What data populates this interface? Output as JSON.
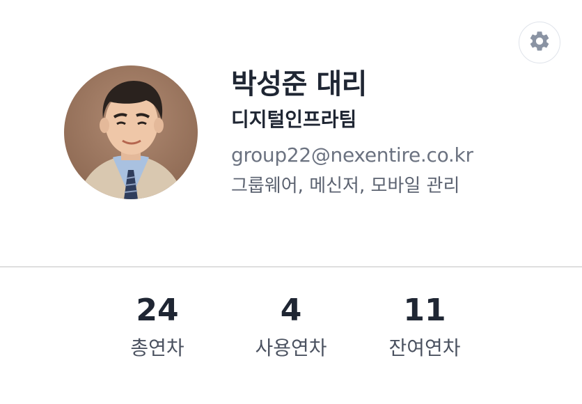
{
  "profile": {
    "name": "박성준 대리",
    "team": "디지털인프라팀",
    "email": "group22@nexentire.co.kr",
    "duty": "그룹웨어, 메신저, 모바일 관리",
    "avatar_icon": "user-photo"
  },
  "settings": {
    "icon": "gear-icon",
    "color": "#8a93a3"
  },
  "stats": [
    {
      "value": "24",
      "label": "총연차"
    },
    {
      "value": "4",
      "label": "사용연차"
    },
    {
      "value": "11",
      "label": "잔여연차"
    }
  ]
}
